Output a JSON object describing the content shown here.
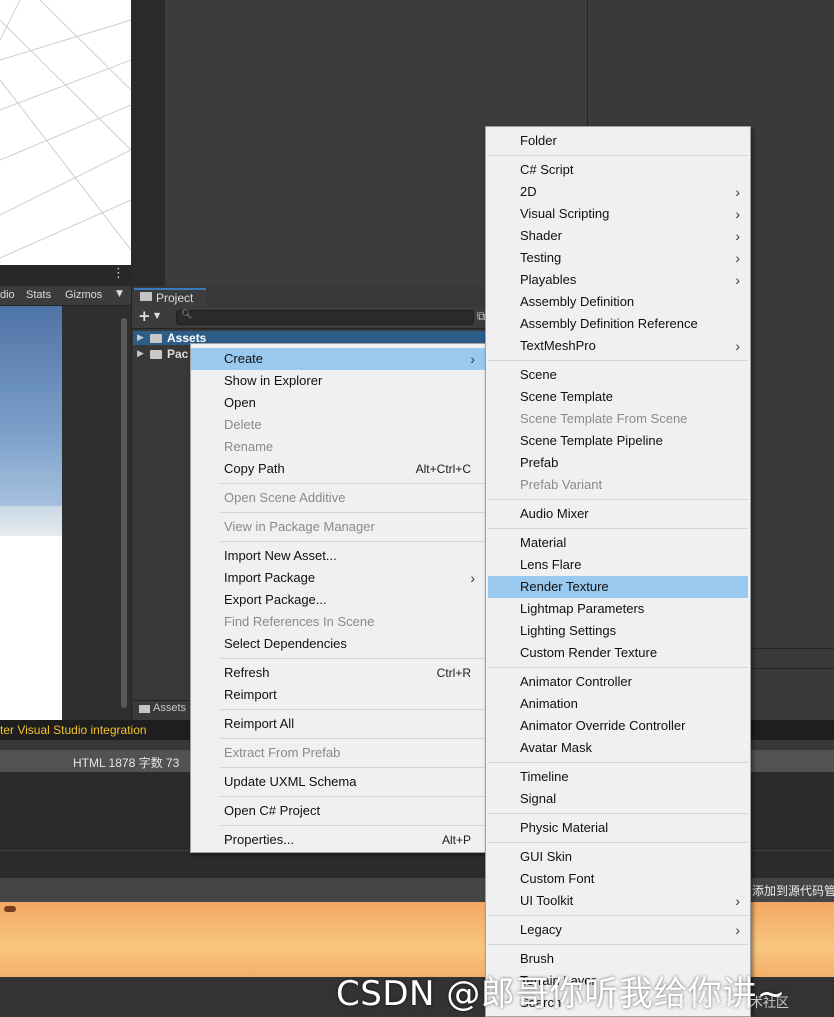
{
  "scene_toolbar": {
    "items": [
      "dio",
      "Stats",
      "Gizmos"
    ],
    "menu_icon": "kebab-icon"
  },
  "project": {
    "tab_label": "Project",
    "tree": [
      "Assets",
      "Pac"
    ],
    "footer_label": "Assets"
  },
  "status": {
    "text": "ter Visual Studio integration"
  },
  "info_bar": {
    "text": "HTML  1878 字数  73"
  },
  "right_text": "添加到源代码管理",
  "context_menu": {
    "groups": [
      [
        {
          "label": "Create",
          "submenu": true,
          "highlight": true
        },
        {
          "label": "Show in Explorer"
        },
        {
          "label": "Open"
        },
        {
          "label": "Delete",
          "disabled": true
        },
        {
          "label": "Rename",
          "disabled": true
        },
        {
          "label": "Copy Path",
          "shortcut": "Alt+Ctrl+C"
        }
      ],
      [
        {
          "label": "Open Scene Additive",
          "disabled": true
        }
      ],
      [
        {
          "label": "View in Package Manager",
          "disabled": true
        }
      ],
      [
        {
          "label": "Import New Asset..."
        },
        {
          "label": "Import Package",
          "submenu": true
        },
        {
          "label": "Export Package..."
        },
        {
          "label": "Find References In Scene",
          "disabled": true
        },
        {
          "label": "Select Dependencies"
        }
      ],
      [
        {
          "label": "Refresh",
          "shortcut": "Ctrl+R"
        },
        {
          "label": "Reimport"
        }
      ],
      [
        {
          "label": "Reimport All"
        }
      ],
      [
        {
          "label": "Extract From Prefab",
          "disabled": true
        }
      ],
      [
        {
          "label": "Update UXML Schema"
        }
      ],
      [
        {
          "label": "Open C# Project"
        }
      ],
      [
        {
          "label": "Properties...",
          "shortcut": "Alt+P"
        }
      ]
    ]
  },
  "create_menu": {
    "groups": [
      [
        {
          "label": "Folder"
        }
      ],
      [
        {
          "label": "C# Script"
        },
        {
          "label": "2D",
          "submenu": true
        },
        {
          "label": "Visual Scripting",
          "submenu": true
        },
        {
          "label": "Shader",
          "submenu": true
        },
        {
          "label": "Testing",
          "submenu": true
        },
        {
          "label": "Playables",
          "submenu": true
        },
        {
          "label": "Assembly Definition"
        },
        {
          "label": "Assembly Definition Reference"
        },
        {
          "label": "TextMeshPro",
          "submenu": true
        }
      ],
      [
        {
          "label": "Scene"
        },
        {
          "label": "Scene Template"
        },
        {
          "label": "Scene Template From Scene",
          "disabled": true
        },
        {
          "label": "Scene Template Pipeline"
        },
        {
          "label": "Prefab"
        },
        {
          "label": "Prefab Variant",
          "disabled": true
        }
      ],
      [
        {
          "label": "Audio Mixer"
        }
      ],
      [
        {
          "label": "Material"
        },
        {
          "label": "Lens Flare"
        },
        {
          "label": "Render Texture",
          "highlight": true
        },
        {
          "label": "Lightmap Parameters"
        },
        {
          "label": "Lighting Settings"
        },
        {
          "label": "Custom Render Texture"
        }
      ],
      [
        {
          "label": "Animator Controller"
        },
        {
          "label": "Animation"
        },
        {
          "label": "Animator Override Controller"
        },
        {
          "label": "Avatar Mask"
        }
      ],
      [
        {
          "label": "Timeline"
        },
        {
          "label": "Signal"
        }
      ],
      [
        {
          "label": "Physic Material"
        }
      ],
      [
        {
          "label": "GUI Skin"
        },
        {
          "label": "Custom Font"
        },
        {
          "label": "UI Toolkit",
          "submenu": true
        }
      ],
      [
        {
          "label": "Legacy",
          "submenu": true
        }
      ],
      [
        {
          "label": "Brush"
        },
        {
          "label": "Terrain Layer"
        },
        {
          "label": "Search"
        }
      ]
    ]
  },
  "watermark": {
    "main": "CSDN @郎哥你听我给你讲~",
    "sub": "@稀土掘金技术社区"
  },
  "colors": {
    "menu_bg": "#f0f0f0",
    "menu_highlight": "#99c9ef",
    "assets_selected": "#2c5d87",
    "status_warning": "#f2c02e"
  }
}
